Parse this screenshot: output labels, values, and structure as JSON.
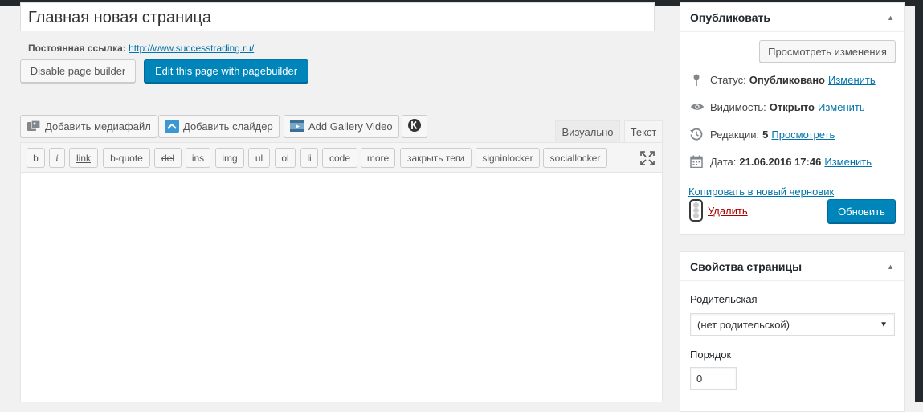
{
  "title": {
    "value": "Главная новая страница"
  },
  "permalink": {
    "label": "Постоянная ссылка:",
    "url": "http://www.successtrading.ru/"
  },
  "builder": {
    "disable_label": "Disable page builder",
    "edit_label": "Edit this page with pagebuilder"
  },
  "media_buttons": {
    "add_media": "Добавить медиафайл",
    "add_slider": "Добавить слайдер",
    "add_gallery_video": "Add Gallery Video"
  },
  "editor_tabs": {
    "visual": "Визуально",
    "text": "Текст",
    "active": "text"
  },
  "quicktags": [
    "b",
    "i",
    "link",
    "b-quote",
    "del",
    "ins",
    "img",
    "ul",
    "ol",
    "li",
    "code",
    "more",
    "закрыть теги",
    "signinlocker",
    "sociallocker"
  ],
  "publish": {
    "title": "Опубликовать",
    "preview_label": "Просмотреть изменения",
    "status_label": "Статус:",
    "status_value": "Опубликовано",
    "visibility_label": "Видимость:",
    "visibility_value": "Открыто",
    "revisions_label": "Редакции:",
    "revisions_value": "5",
    "revisions_link": "Просмотреть",
    "date_label": "Дата:",
    "date_value": "21.06.2016 17:46",
    "edit_link": "Изменить",
    "copy_draft_link": "Копировать в новый черновик",
    "delete_link": "Удалить",
    "update_label": "Обновить"
  },
  "page_attributes": {
    "title": "Свойства страницы",
    "parent_label": "Родительская",
    "parent_value": "(нет родительской)",
    "order_label": "Порядок",
    "order_value": "0"
  },
  "colors": {
    "primary": "#0085ba",
    "link": "#0073aa",
    "danger": "#a00",
    "admin_bar": "#23282d"
  }
}
